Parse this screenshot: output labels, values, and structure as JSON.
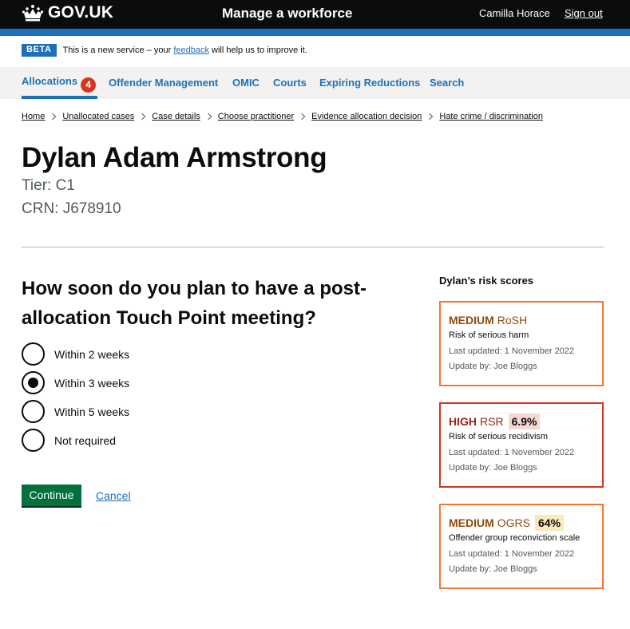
{
  "header": {
    "logo_text": "GOV.UK",
    "service_name": "Manage a workforce",
    "user_name": "Camilla Horace",
    "sign_out": "Sign out"
  },
  "phase_banner": {
    "tag": "BETA",
    "text_before": "This is a new service – your ",
    "link": "feedback",
    "text_after": " will help us to improve it."
  },
  "nav": {
    "items": [
      {
        "label": "Allocations",
        "badge": "4",
        "active": true
      },
      {
        "label": "Offender Management"
      },
      {
        "label": "OMIC"
      },
      {
        "label": "Courts"
      },
      {
        "label": "Expiring Reductions"
      },
      {
        "label": "Search"
      }
    ]
  },
  "breadcrumbs": [
    "Home",
    "Unallocated cases",
    "Case details",
    "Choose practitioner",
    "Evidence allocation decision",
    "Hate crime / discrimination"
  ],
  "person": {
    "name": "Dylan Adam Armstrong",
    "tier": "Tier: C1",
    "crn": "CRN: J678910"
  },
  "form": {
    "question": "How soon do you plan to have a post-allocation Touch Point meeting?",
    "options": [
      {
        "label": "Within 2 weeks",
        "checked": false
      },
      {
        "label": "Within 3 weeks",
        "checked": true
      },
      {
        "label": "Within 5 weeks",
        "checked": false
      },
      {
        "label": "Not required",
        "checked": false
      }
    ],
    "continue": "Continue",
    "cancel": "Cancel"
  },
  "risk": {
    "heading": "Dylan’s risk scores",
    "cards": [
      {
        "level": "MEDIUM",
        "name": "RoSH",
        "percent": "",
        "description": "Risk of serious harm",
        "updated": "Last updated: 1 November 2022",
        "by": "Update by: Joe Bloggs",
        "border_color": "#f47738"
      },
      {
        "level": "HIGH",
        "name": "RSR",
        "percent": "6.9%",
        "description": "Risk of serious recidivism",
        "updated": "Last updated: 1 November 2022",
        "by": "Update by: Joe Bloggs",
        "border_color": "#d4351c"
      },
      {
        "level": "MEDIUM",
        "name": "OGRS",
        "percent": "64%",
        "description": "Offender group reconviction scale",
        "updated": "Last updated: 1 November 2022",
        "by": "Update by: Joe Bloggs",
        "border_color": "#f47738"
      }
    ]
  },
  "colors": {
    "header_bg": "#0b0c0c",
    "brand_blue": "#1d70b8",
    "button_green": "#00703c",
    "badge_red": "#d4351c",
    "nav_bg": "#f3f2f1"
  }
}
